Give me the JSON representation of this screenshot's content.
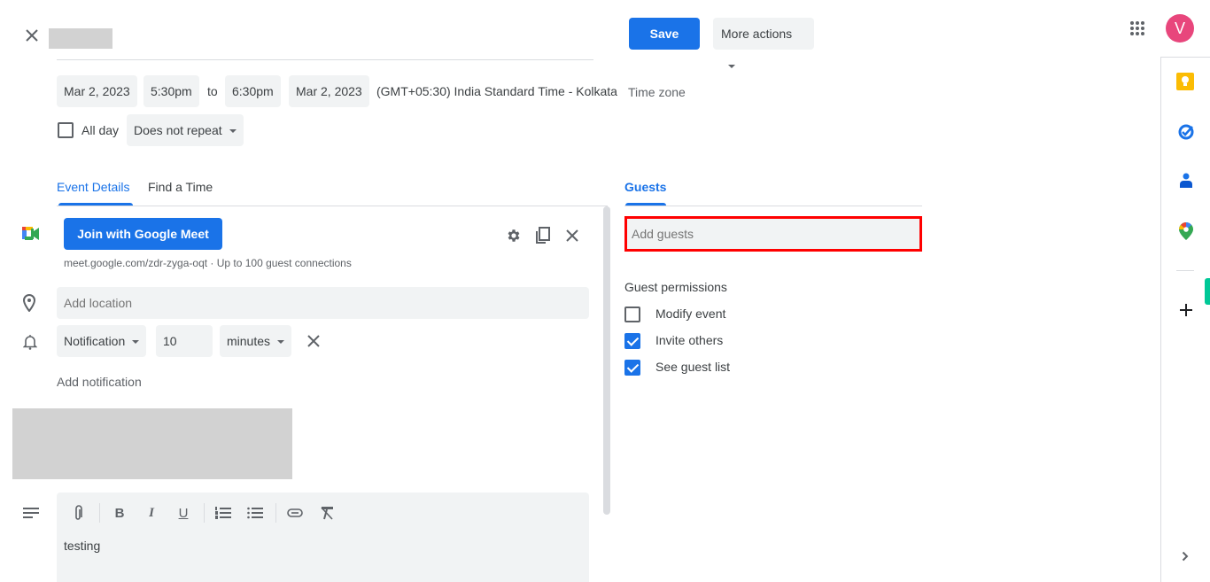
{
  "header": {
    "title_redacted": true,
    "save_label": "Save",
    "more_actions_label": "More actions",
    "avatar_letter": "V"
  },
  "datetime": {
    "start_date": "Mar 2, 2023",
    "start_time": "5:30pm",
    "to_label": "to",
    "end_time": "6:30pm",
    "end_date": "Mar 2, 2023",
    "timezone_text": "(GMT+05:30) India Standard Time - Kolkata",
    "timezone_button": "Time zone",
    "all_day_label": "All day",
    "all_day_checked": false,
    "repeat_value": "Does not repeat"
  },
  "tabs": [
    {
      "label": "Event Details",
      "active": true
    },
    {
      "label": "Find a Time",
      "active": false
    }
  ],
  "meet": {
    "join_label": "Join with Google Meet",
    "info": "meet.google.com/zdr-zyga-oqt · Up to 100 guest connections"
  },
  "location": {
    "placeholder": "Add location",
    "value": ""
  },
  "notification": {
    "type": "Notification",
    "amount": "10",
    "unit": "minutes",
    "add_label": "Add notification"
  },
  "description": {
    "text": "testing"
  },
  "guests": {
    "tab_label": "Guests",
    "input_placeholder": "Add guests",
    "permissions_title": "Guest permissions",
    "permissions": [
      {
        "label": "Modify event",
        "checked": false
      },
      {
        "label": "Invite others",
        "checked": true
      },
      {
        "label": "See guest list",
        "checked": true
      }
    ]
  },
  "side_panel": {
    "apps": [
      "Keep",
      "Tasks",
      "Contacts",
      "Maps"
    ],
    "add_label": "+"
  },
  "colors": {
    "accent": "#1a73e8",
    "highlight_border": "#ff0000",
    "avatar_bg": "#e8467c",
    "field_bg": "#f1f3f4"
  }
}
